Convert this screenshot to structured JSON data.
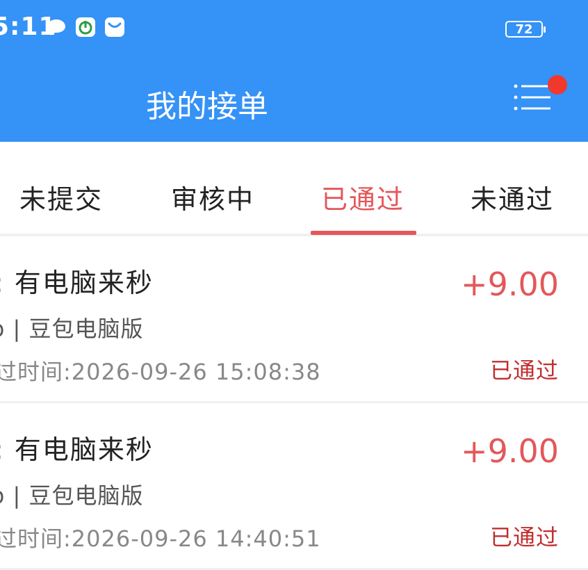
{
  "status_bar": {
    "time": "5:11",
    "icons": [
      "chat-bubble-icon",
      "power-app-icon",
      "mail-icon"
    ],
    "battery": "72"
  },
  "header": {
    "title": "我的接单",
    "menu_icon": "list-menu-icon",
    "background": "#3592f6",
    "badge_color": "#f0382d"
  },
  "tabs": [
    {
      "label": "未提交",
      "active": false
    },
    {
      "label": "审核中",
      "active": false
    },
    {
      "label": "已通过",
      "active": true
    },
    {
      "label": "未通过",
      "active": false
    }
  ],
  "accent_color": "#e4575a",
  "orders": [
    {
      "title": ": 有电脑来秒",
      "subtitle": "b | 豆包电脑版",
      "time": "过时间:2026-09-26  15:08:38",
      "amount": "+9.00",
      "status": "已通过"
    },
    {
      "title": ": 有电脑来秒",
      "subtitle": "b | 豆包电脑版",
      "time": "过时间:2026-09-26  14:40:51",
      "amount": "+9.00",
      "status": "已通过"
    }
  ]
}
